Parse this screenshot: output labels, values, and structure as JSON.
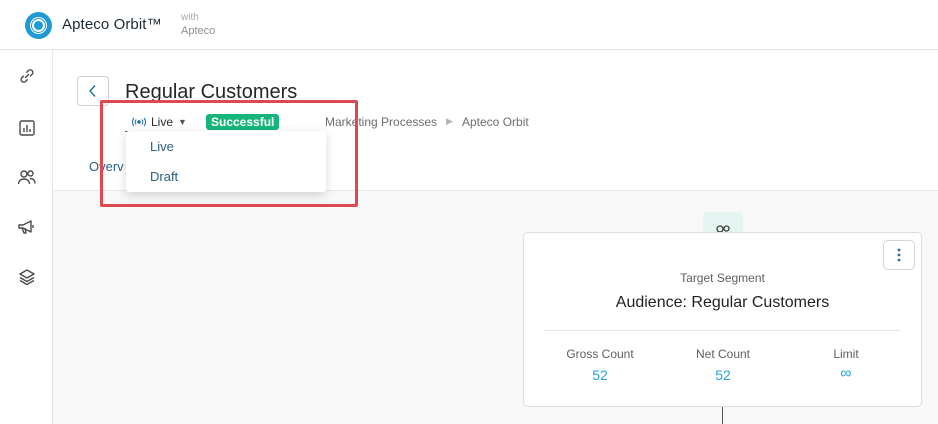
{
  "app": {
    "brand": "Apteco Orbit™",
    "with_label": "with",
    "with_brand": "Apteco"
  },
  "sidebar": {
    "items": [
      {
        "icon": "link-icon"
      },
      {
        "icon": "dashboard-icon"
      },
      {
        "icon": "people-icon"
      },
      {
        "icon": "megaphone-icon"
      },
      {
        "icon": "layers-icon"
      }
    ]
  },
  "page": {
    "title": "Regular Customers",
    "status_selected": "Live",
    "status_badge": "Successful",
    "breadcrumb": [
      "Marketing Processes",
      "Apteco Orbit"
    ],
    "tab_partial": "Overv"
  },
  "dropdown": {
    "options": [
      "Live",
      "Draft"
    ]
  },
  "card": {
    "subtitle": "Target Segment",
    "title": "Audience: Regular Customers",
    "stats": [
      {
        "label": "Gross Count",
        "value": "52"
      },
      {
        "label": "Net Count",
        "value": "52"
      },
      {
        "label": "Limit",
        "value": "∞"
      }
    ]
  },
  "colors": {
    "accent": "#1e9bd7",
    "success": "#16b67b",
    "link": "#2a5f80",
    "stat_value": "#2aa3dd",
    "highlight": "#e0484f"
  }
}
